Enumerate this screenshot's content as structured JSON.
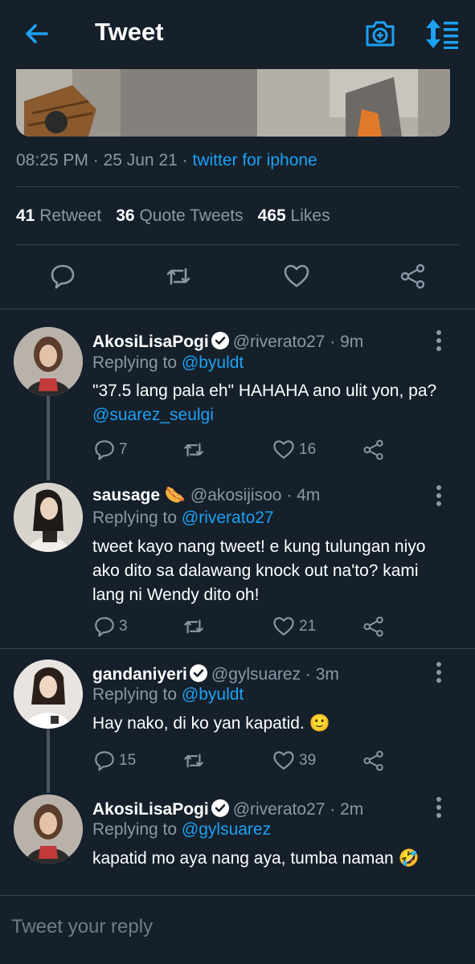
{
  "header": {
    "title": "Tweet"
  },
  "tweet": {
    "time": "08:25 PM",
    "date": "25 Jun 21",
    "source": "twitter for iphone",
    "stats": {
      "retweets_count": "41",
      "retweets_label": "Retweet",
      "quotes_count": "36",
      "quotes_label": "Quote Tweets",
      "likes_count": "465",
      "likes_label": "Likes"
    }
  },
  "replies": [
    {
      "display_name": "AkosiLisaPogi",
      "verified": true,
      "handle": "@riverato27",
      "time": "9m",
      "replying_prefix": "Replying to",
      "replying_to": "@byuldt",
      "text": "\"37.5 lang pala eh\" HAHAHA ano ulit yon, pa?",
      "text_mention": "@suarez_seulgi",
      "reply_count": "7",
      "retweet_count": "",
      "like_count": "16"
    },
    {
      "display_name": "sausage",
      "emoji": "🌭",
      "handle": "@akosijisoo",
      "time": "4m",
      "replying_prefix": "Replying to",
      "replying_to": "@riverato27",
      "text": "tweet kayo nang tweet! e kung tulungan niyo ako dito sa dalawang knock out na'to? kami lang ni Wendy dito oh!",
      "reply_count": "3",
      "retweet_count": "",
      "like_count": "21"
    },
    {
      "display_name": "gandaniyeri",
      "verified": true,
      "handle": "@gylsuarez",
      "time": "3m",
      "replying_prefix": "Replying to",
      "replying_to": "@byuldt",
      "text": "Hay nako, di ko yan kapatid. 🙂",
      "reply_count": "15",
      "retweet_count": "",
      "like_count": "39"
    },
    {
      "display_name": "AkosiLisaPogi",
      "verified": true,
      "handle": "@riverato27",
      "time": "2m",
      "replying_prefix": "Replying to",
      "replying_to": "@gylsuarez",
      "text": "kapatid mo aya nang aya, tumba naman 🤣"
    }
  ],
  "composer": {
    "placeholder": "Tweet your reply"
  },
  "colors": {
    "background": "#15202b",
    "accent": "#1da1f2",
    "muted": "#8899a6",
    "divider": "#38444d"
  }
}
